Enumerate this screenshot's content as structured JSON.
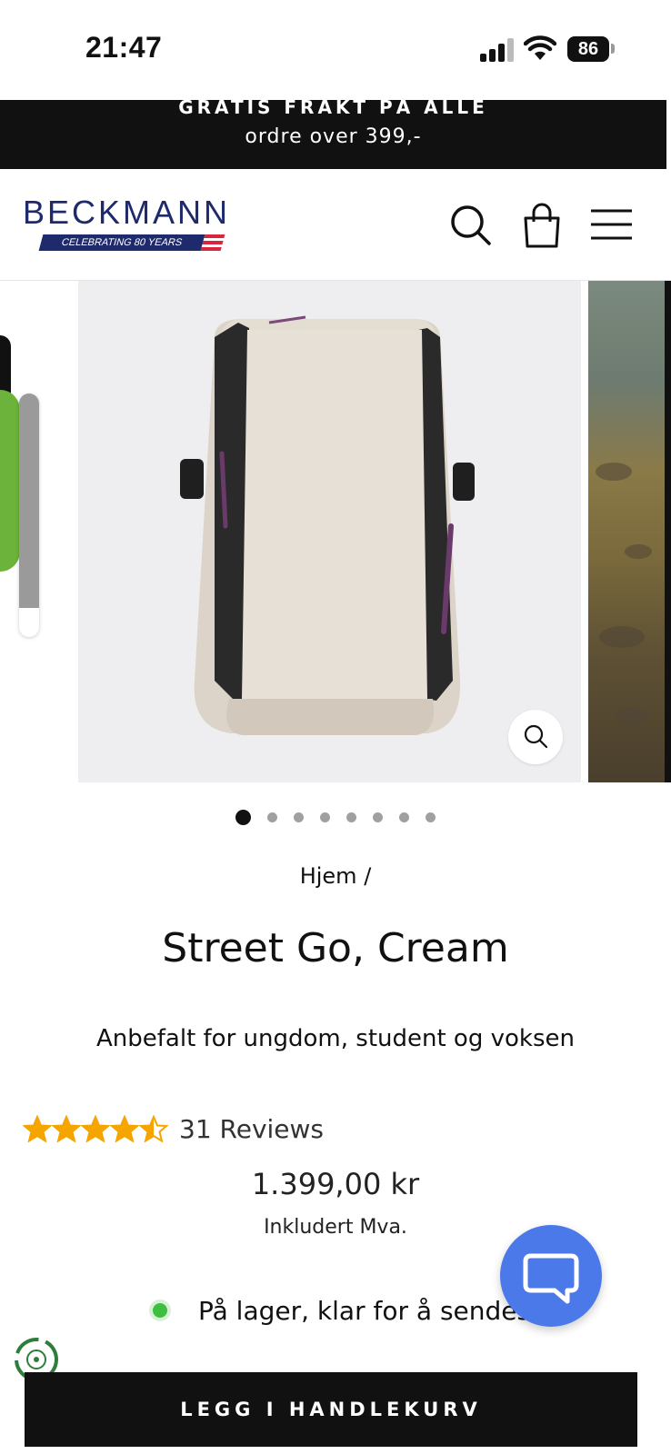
{
  "status_bar": {
    "time": "21:47",
    "battery": "86"
  },
  "promo": {
    "line1": "GRATIS FRAKT PÅ ALLE",
    "line2": "ordre over 399,-"
  },
  "header": {
    "logo_text": "BECKMANN",
    "logo_tagline": "CELEBRATING 80 YEARS",
    "icons": [
      "search-icon",
      "shopping-bag-icon",
      "menu-icon"
    ]
  },
  "gallery": {
    "slide_count": 8,
    "active_slide": 1
  },
  "breadcrumb": "Hjem /",
  "product": {
    "title": "Street Go, Cream",
    "subtitle": "Anbefalt for ungdom, student og voksen",
    "rating": 4.5,
    "reviews_label": "31 Reviews",
    "price": "1.399,00 kr",
    "vat_note": "Inkludert Mva.",
    "stock_text": "På lager, klar for å sendes",
    "add_to_cart": "LEGG I HANDLEKURV"
  },
  "colors": {
    "brand_navy": "#1e2a6b",
    "star": "#f5a400",
    "stock_green": "#3fbf3f",
    "chat_blue": "#4c79e9",
    "banner": "#111111"
  }
}
